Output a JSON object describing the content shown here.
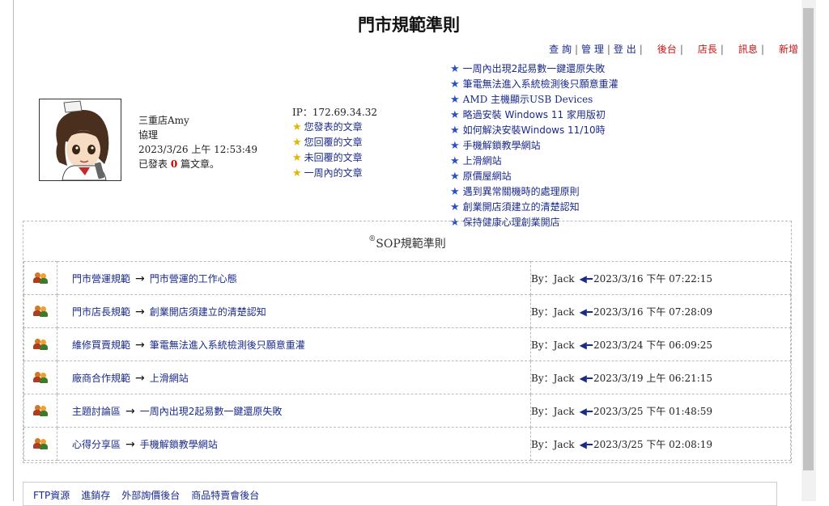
{
  "page_title": "門市規範準則",
  "topnav": [
    {
      "label": "查 詢",
      "color": "blue"
    },
    {
      "label": "管 理",
      "color": "blue"
    },
    {
      "label": "登 出",
      "color": "blue"
    },
    {
      "label": "後台",
      "color": "red"
    },
    {
      "label": "店長",
      "color": "red"
    },
    {
      "label": "訊息",
      "color": "red"
    },
    {
      "label": "新增",
      "color": "red"
    }
  ],
  "user": {
    "name": "三重店Amy",
    "role": "協理",
    "datetime": "2023/3/26 上午 12:53:49",
    "posts_prefix": "已發表",
    "posts_count": "0",
    "posts_suffix": "篇文章。"
  },
  "stats": {
    "ip": "IP：172.69.34.32",
    "links": [
      "您發表的文章",
      "您回覆的文章",
      "未回覆的文章",
      "一周內的文章"
    ]
  },
  "news": [
    "一周內出現2起易數一鍵還原失敗",
    "筆電無法進入系統檢測後只願意重灌",
    "AMD 主機顯示USB Devices",
    "略過安裝 Windows 11 家用版初",
    "如何解決安裝Windows 11/10時",
    "手機解鎖教學網站",
    "上滑網站",
    "原價屋網站",
    "遇到異常關機時的處理原則",
    "創業開店須建立的清楚認知",
    "保持健康心理創業開店"
  ],
  "sop": {
    "title_symbol": "®",
    "title": "SOP規範準則",
    "rows": [
      {
        "category": "門市營運規範",
        "topic": "門市營運的工作心態",
        "by": "By：Jack",
        "date": "2023/3/16 下午 07:22:15"
      },
      {
        "category": "門市店長規範",
        "topic": "創業開店須建立的清楚認知",
        "by": "By：Jack",
        "date": "2023/3/16 下午 07:28:09"
      },
      {
        "category": "維修買賣規範",
        "topic": "筆電無法進入系統檢測後只願意重灌",
        "by": "By：Jack",
        "date": "2023/3/24 下午 06:09:25"
      },
      {
        "category": "廠商合作規範",
        "topic": "上滑網站",
        "by": "By：Jack",
        "date": "2023/3/19 上午 06:21:15"
      },
      {
        "category": "主題討論區",
        "topic": "一周內出現2起易數一鍵還原失敗",
        "by": "By：Jack",
        "date": "2023/3/25 下午 01:48:59"
      },
      {
        "category": "心得分享區",
        "topic": "手機解鎖教學網站",
        "by": "By：Jack",
        "date": "2023/3/25 下午 02:08:19"
      }
    ]
  },
  "bottom_links": [
    "FTP資源",
    "進銷存",
    "外部詢價後台",
    "商品特賣會後台"
  ],
  "colors": {
    "link_blue": "#1a2a8a",
    "accent_red": "#cc1111",
    "star_blue": "#2a4fc8",
    "star_yellow": "#e0b800"
  }
}
